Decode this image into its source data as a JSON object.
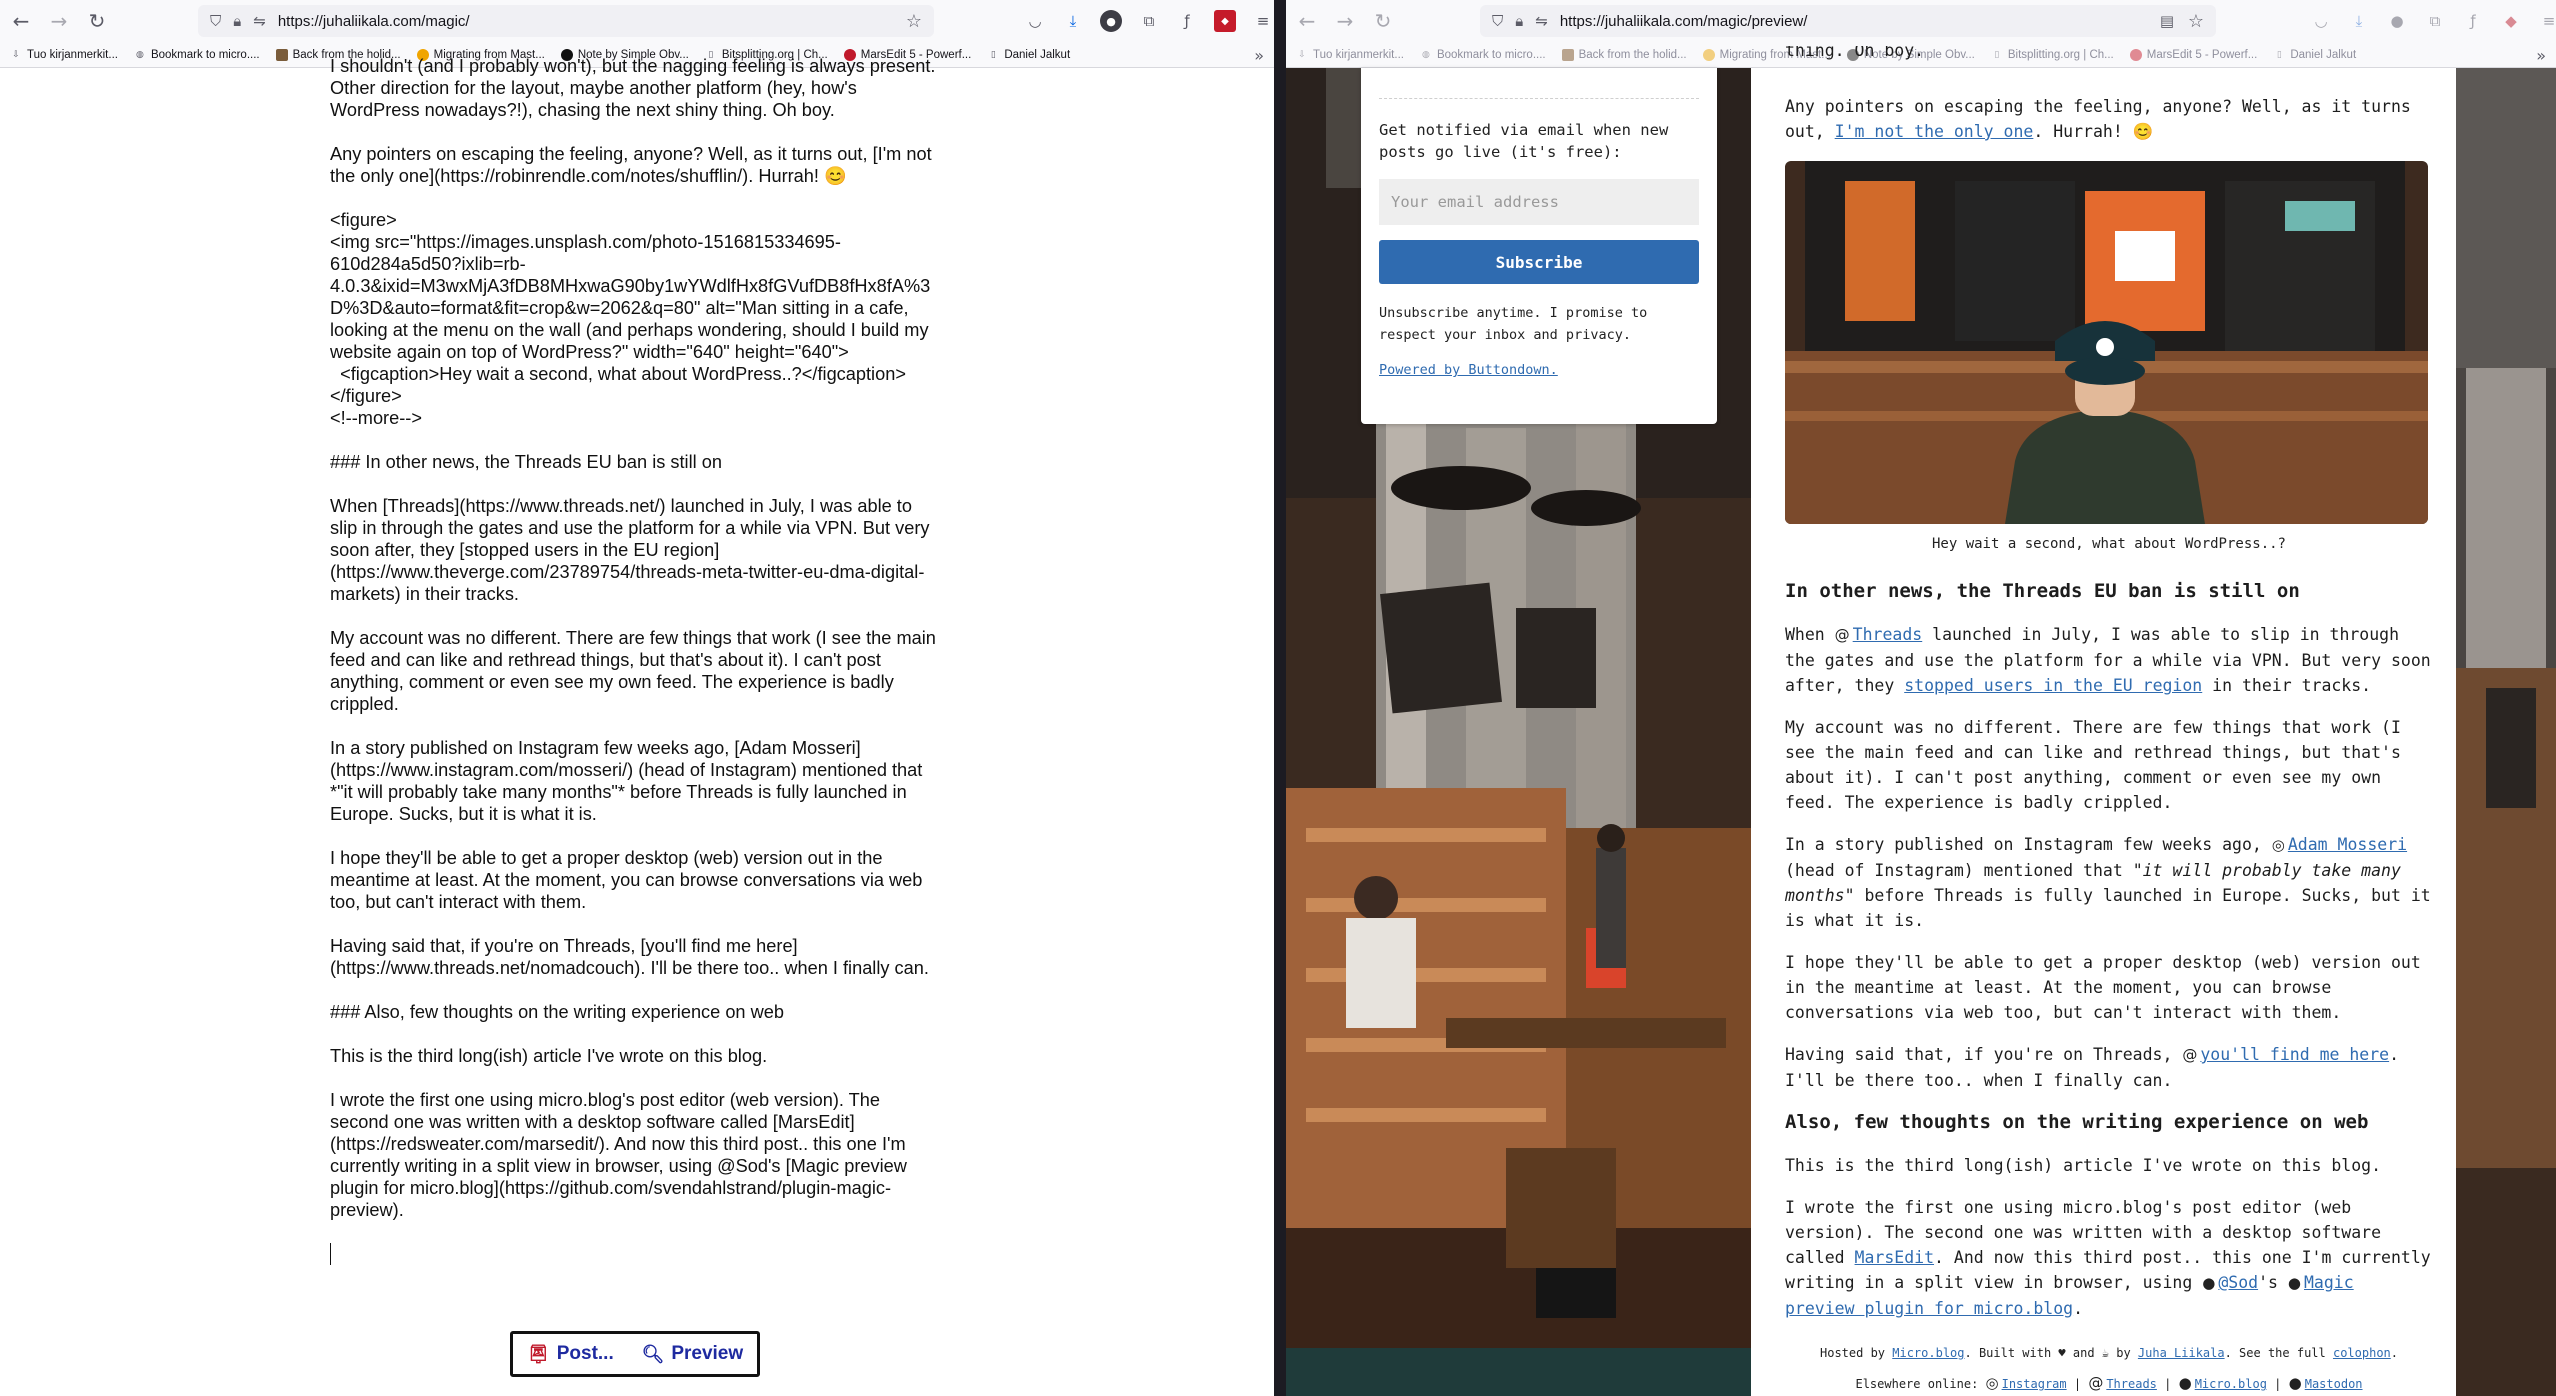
{
  "left": {
    "url": "https://juhaliikala.com/magic/",
    "bookmarks": [
      "Tuo kirjanmerkit...",
      "Bookmark to micro....",
      "Back from the holid...",
      "Migrating from Mast...",
      "Note by Simple Obv...",
      "Bitsplitting.org | Ch...",
      "MarsEdit 5 - Powerf...",
      "Daniel Jalkut"
    ],
    "editor": {
      "cut_line": "I shouldn't (and I probably won't), but the nagging feeling is always present. Other direction for the layout, maybe another platform (hey, how's WordPress nowadays?!), chasing the next shiny thing. Oh boy.",
      "p1": "Any pointers on escaping the feeling, anyone? Well, as it turns out, [I'm not the only one](https://robinrendle.com/notes/shufflin/). Hurrah! 😊",
      "p2": "<figure>\n<img src=\"https://images.unsplash.com/photo-1516815334695-610d284a5d50?ixlib=rb-4.0.3&ixid=M3wxMjA3fDB8MHxwaG90by1wYWdlfHx8fGVufDB8fHx8fA%3D%3D&auto=format&fit=crop&w=2062&q=80\" alt=\"Man sitting in a cafe, looking at the menu on the wall (and perhaps wondering, should I build my website again on top of WordPress?\" width=\"640\" height=\"640\">\n  <figcaption>Hey wait a second, what about WordPress..?</figcaption>\n</figure>\n<!--more-->",
      "p3": "### In other news, the Threads EU ban is still on",
      "p4": "When [Threads](https://www.threads.net/) launched in July, I was able to slip in through the gates and use the platform for a while via VPN. But very soon after, they [stopped users in the EU region](https://www.theverge.com/23789754/threads-meta-twitter-eu-dma-digital-markets) in their tracks.",
      "p5": "My account was no different. There are few things that work (I see the main feed and can like and rethread things, but that's about it). I can't post anything, comment or even see my own feed. The experience is badly crippled.",
      "p6": "In a story published on Instagram few weeks ago, [Adam Mosseri](https://www.instagram.com/mosseri/) (head of Instagram) mentioned that *\"it will probably take many months\"* before Threads is fully launched in Europe. Sucks, but it is what it is.",
      "p7": "I hope they'll be able to get a proper desktop (web) version out in the meantime at least. At the moment, you can browse conversations via web too, but can't interact with them.",
      "p8": "Having said that, if you're on Threads, [you'll find me here](https://www.threads.net/nomadcouch). I'll be there too.. when I finally can.",
      "p9": "### Also, few thoughts on the writing experience on web",
      "p10": "This is the third long(ish) article I've wrote on this blog.",
      "p11": "I wrote the first one using micro.blog's post editor (web version). The second one was written with a desktop software called [MarsEdit](https://redsweater.com/marsedit/). And now this third post.. this one I'm currently writing in a split view in browser, using @Sod's [Magic preview plugin for micro.blog](https://github.com/svendahlstrand/plugin-magic-preview)."
    },
    "buttons": {
      "post": "Post...",
      "preview": "Preview"
    }
  },
  "right": {
    "url": "https://juhaliikala.com/magic/preview/",
    "bookmarks": [
      "Tuo kirjanmerkit...",
      "Bookmark to micro....",
      "Back from the holid...",
      "Migrating from Mast...",
      "Note by Simple Obv...",
      "Bitsplitting.org | Ch...",
      "MarsEdit 5 - Powerf...",
      "Daniel Jalkut"
    ],
    "top_cut": "thing. Oh boy.",
    "sidebar": {
      "notify": "Get notified via email when new posts go live (it's free):",
      "email_placeholder": "Your email address",
      "subscribe": "Subscribe",
      "unsubscribe": "Unsubscribe anytime. I promise to respect your inbox and privacy.",
      "powered": "Powered by Buttondown."
    },
    "article": {
      "p1_a": "Any pointers on escaping the feeling, anyone? Well, as it turns out, ",
      "p1_link": "I'm not the only one",
      "p1_b": ". Hurrah! 😊",
      "caption": "Hey wait a second, what about WordPress..?",
      "h1": "In other news, the Threads EU ban is still on",
      "p2_a": "When ",
      "p2_link1": "Threads",
      "p2_b": " launched in July, I was able to slip in through the gates and use the platform for a while via VPN. But very soon after, they ",
      "p2_link2": "stopped users in the EU region",
      "p2_c": " in their tracks.",
      "p3": "My account was no different. There are few things that work (I see the main feed and can like and rethread things, but that's about it). I can't post anything, comment or even see my own feed. The experience is badly crippled.",
      "p4_a": "In a story published on Instagram few weeks ago, ",
      "p4_link": "Adam Mosseri",
      "p4_b": " (head of Instagram) mentioned that ",
      "p4_em": "\"it will probably take many months\"",
      "p4_c": " before Threads is fully launched in Europe. Sucks, but it is what it is.",
      "p5": "I hope they'll be able to get a proper desktop (web) version out in the meantime at least. At the moment, you can browse conversations via web too, but can't interact with them.",
      "p6_a": "Having said that, if you're on Threads, ",
      "p6_link": "you'll find me here",
      "p6_b": ". I'll be there too.. when I finally can.",
      "h2": "Also, few thoughts on the writing experience on web",
      "p7": "This is the third long(ish) article I've wrote on this blog.",
      "p8_a": "I wrote the first one using micro.blog's post editor (web version). The second one was written with a desktop software called ",
      "p8_link1": "MarsEdit",
      "p8_b": ". And now this third post.. this one I'm currently writing in a split view in browser, using ",
      "p8_link2": "@Sod",
      "p8_c": "'s ",
      "p8_link3": "Magic preview plugin for micro.blog",
      "p8_d": "."
    },
    "footer": {
      "hosted": "Hosted by ",
      "microblog": "Micro.blog",
      "built": ". Built with ♥ and ☕ by ",
      "author": "Juha Liikala",
      "see": ". See the full ",
      "colophon": "colophon",
      "end": ".",
      "elsewhere": "Elsewhere online: ",
      "links": [
        "Instagram",
        "Threads",
        "Micro.blog",
        "Mastodon"
      ]
    }
  },
  "colors": {
    "link": "#2f6bb0",
    "subscribe": "#2f6bb0",
    "divider": "#1c1b22"
  }
}
